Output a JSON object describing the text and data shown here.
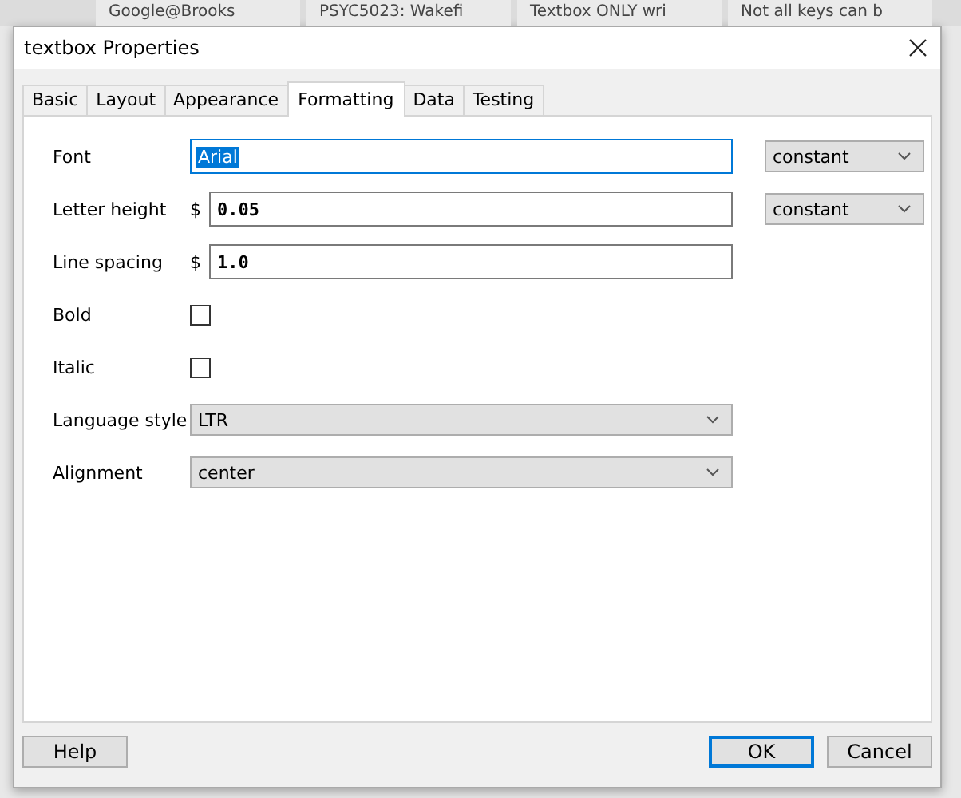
{
  "browser_tabs": [
    {
      "title": "Google@Brooks"
    },
    {
      "title": "PSYC5023: Wakefi"
    },
    {
      "title": "Textbox ONLY wri"
    },
    {
      "title": "Not all keys can b"
    }
  ],
  "window": {
    "title": "textbox Properties"
  },
  "tabs": [
    {
      "label": "Basic",
      "selected": false
    },
    {
      "label": "Layout",
      "selected": false
    },
    {
      "label": "Appearance",
      "selected": false
    },
    {
      "label": "Formatting",
      "selected": true
    },
    {
      "label": "Data",
      "selected": false
    },
    {
      "label": "Testing",
      "selected": false
    }
  ],
  "fields": [
    {
      "kind": "text",
      "label": "Font",
      "value": "Arial",
      "highlighted": true,
      "focused": true,
      "mode": "constant"
    },
    {
      "kind": "code",
      "label": "Letter height",
      "prefix": "$",
      "value": "0.05",
      "mode": "constant"
    },
    {
      "kind": "code",
      "label": "Line spacing",
      "prefix": "$",
      "value": "1.0"
    },
    {
      "kind": "checkbox",
      "label": "Bold",
      "checked": false
    },
    {
      "kind": "checkbox",
      "label": "Italic",
      "checked": false
    },
    {
      "kind": "select",
      "label": "Language style",
      "value": "LTR"
    },
    {
      "kind": "select",
      "label": "Alignment",
      "value": "center"
    }
  ],
  "buttons": [
    {
      "label": "Help",
      "default": false
    },
    {
      "label": "OK",
      "default": true
    },
    {
      "label": "Cancel",
      "default": false
    }
  ]
}
